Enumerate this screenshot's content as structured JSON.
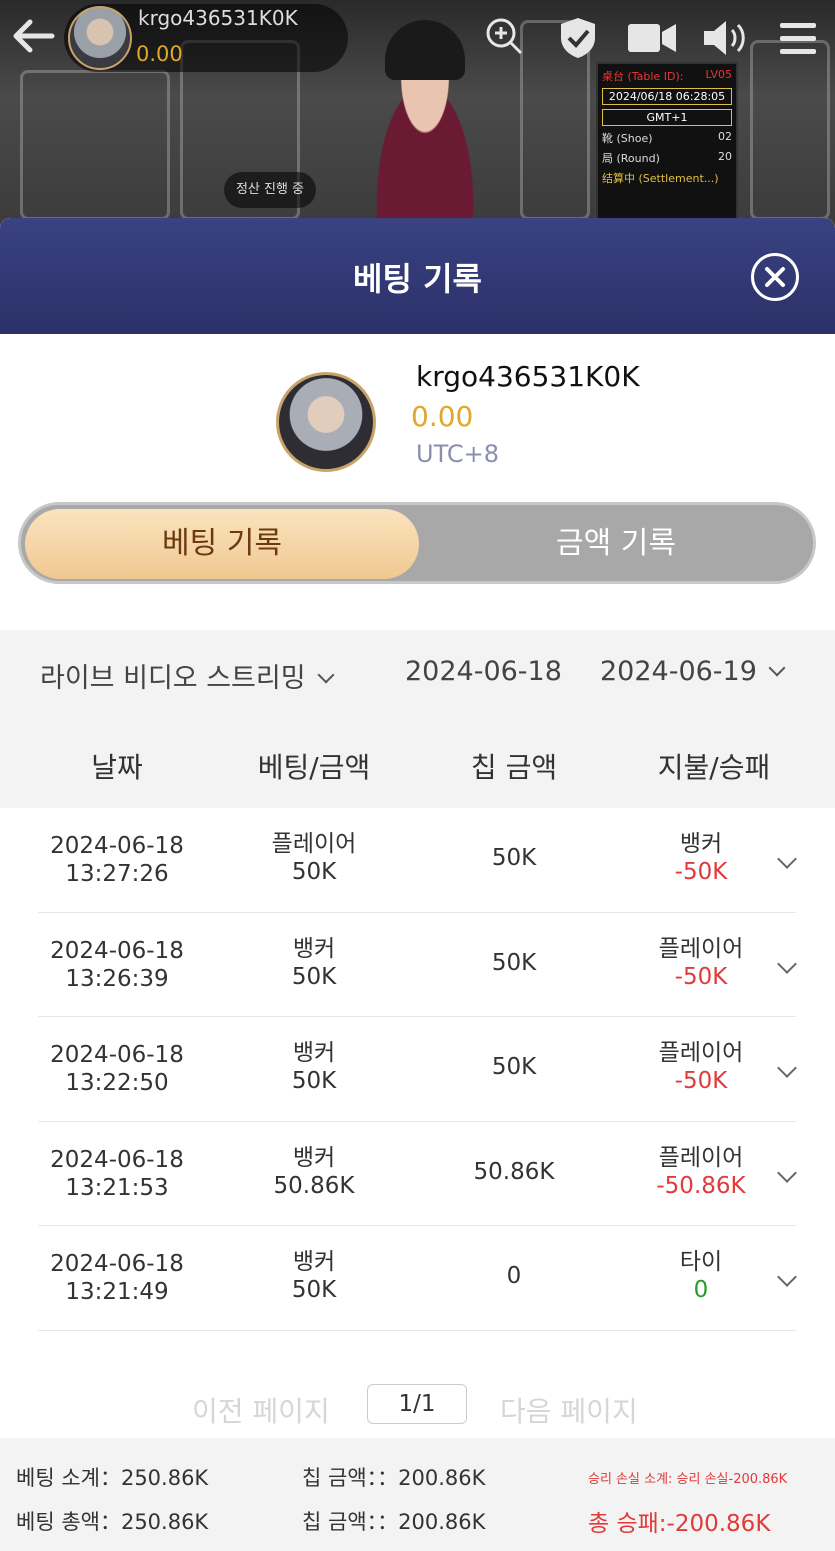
{
  "video": {
    "username": "krgo436531K0K",
    "balance": "0.00",
    "status": "정산 진행 중",
    "table_id_label": "桌台 (Table ID):",
    "table_id": "LV05",
    "datetime": "2024/06/18 06:28:05",
    "timezone": "GMT+1",
    "shoe_label": "靴 (Shoe)",
    "shoe": "02",
    "round_label": "局 (Round)",
    "round": "20",
    "settlement": "结算中 (Settlement...)"
  },
  "modal": {
    "title": "베팅 기록",
    "close_icon": "close-icon"
  },
  "profile": {
    "username": "krgo436531K0K",
    "balance": "0.00",
    "timezone": "UTC+8"
  },
  "tabs": {
    "active": "베팅 기록",
    "inactive": "금액 기록"
  },
  "filters": {
    "game": "라이브 비디오 스트리밍",
    "date_from": "2024-06-18",
    "date_to": "2024-06-19"
  },
  "columns": [
    "날짜",
    "베팅/금액",
    "칩 금액",
    "지불/승패"
  ],
  "rows": [
    {
      "date": "2024-06-18",
      "time": "13:27:26",
      "bet_side": "플레이어",
      "bet_amount": "50K",
      "chip": "50K",
      "result_side": "뱅커",
      "result_amount": "-50K"
    },
    {
      "date": "2024-06-18",
      "time": "13:26:39",
      "bet_side": "뱅커",
      "bet_amount": "50K",
      "chip": "50K",
      "result_side": "플레이어",
      "result_amount": "-50K"
    },
    {
      "date": "2024-06-18",
      "time": "13:22:50",
      "bet_side": "뱅커",
      "bet_amount": "50K",
      "chip": "50K",
      "result_side": "플레이어",
      "result_amount": "-50K"
    },
    {
      "date": "2024-06-18",
      "time": "13:21:53",
      "bet_side": "뱅커",
      "bet_amount": "50.86K",
      "chip": "50.86K",
      "result_side": "플레이어",
      "result_amount": "-50.86K"
    },
    {
      "date": "2024-06-18",
      "time": "13:21:49",
      "bet_side": "뱅커",
      "bet_amount": "50K",
      "chip": "0",
      "result_side": "타이",
      "result_amount": "0"
    }
  ],
  "pager": {
    "prev": "이전 페이지",
    "page": "1/1",
    "next": "다음 페이지"
  },
  "summary": {
    "bet_subtotal": "베팅 소계：250.86K",
    "chip_subtotal": "칩 금액：：200.86K",
    "winloss_subtotal": "승리 손실 소계: 승리 손실-200.86K",
    "bet_total": "베팅 총액：250.86K",
    "chip_total": "칩 금액：：200.86K",
    "winloss_total": "총 승패:-200.86K"
  },
  "colors": {
    "header": "#2f3673",
    "accent_gold": "#e0a82a",
    "loss": "#e03a3a",
    "win": "#2a9a2a"
  }
}
